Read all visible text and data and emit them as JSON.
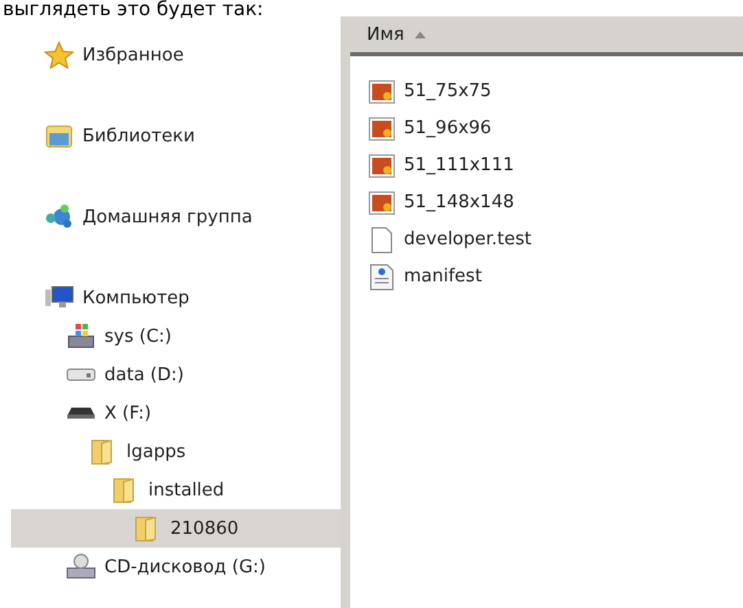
{
  "caption": "выглядеть это будет так:",
  "navigation": {
    "items": [
      {
        "label": "Избранное",
        "kind": "star",
        "selected": false
      },
      {
        "label": "Библиотеки",
        "kind": "library",
        "selected": false
      },
      {
        "label": "Домашняя группа",
        "kind": "homegroup",
        "selected": false
      },
      {
        "label": "Компьютер",
        "kind": "computer",
        "selected": false,
        "children": [
          {
            "label": "sys (C:)",
            "kind": "system-drive",
            "selected": false
          },
          {
            "label": "data (D:)",
            "kind": "drive",
            "selected": false
          },
          {
            "label": "X (F:)",
            "kind": "removable-drive",
            "selected": false,
            "children": [
              {
                "label": "lgapps",
                "kind": "folder",
                "selected": false,
                "children": [
                  {
                    "label": "installed",
                    "kind": "folder",
                    "selected": false,
                    "children": [
                      {
                        "label": "210860",
                        "kind": "folder",
                        "selected": true
                      }
                    ]
                  }
                ]
              }
            ]
          },
          {
            "label": "CD-дисковод (G:)",
            "kind": "cd-drive",
            "selected": false
          }
        ]
      }
    ]
  },
  "file_list": {
    "columns": [
      {
        "label": "Имя",
        "sorted": true
      }
    ],
    "files": [
      {
        "name": "51_75x75",
        "kind": "image"
      },
      {
        "name": "51_96x96",
        "kind": "image"
      },
      {
        "name": "51_111x111",
        "kind": "image"
      },
      {
        "name": "51_148x148",
        "kind": "image"
      },
      {
        "name": "developer.test",
        "kind": "blank"
      },
      {
        "name": "manifest",
        "kind": "config"
      }
    ]
  }
}
